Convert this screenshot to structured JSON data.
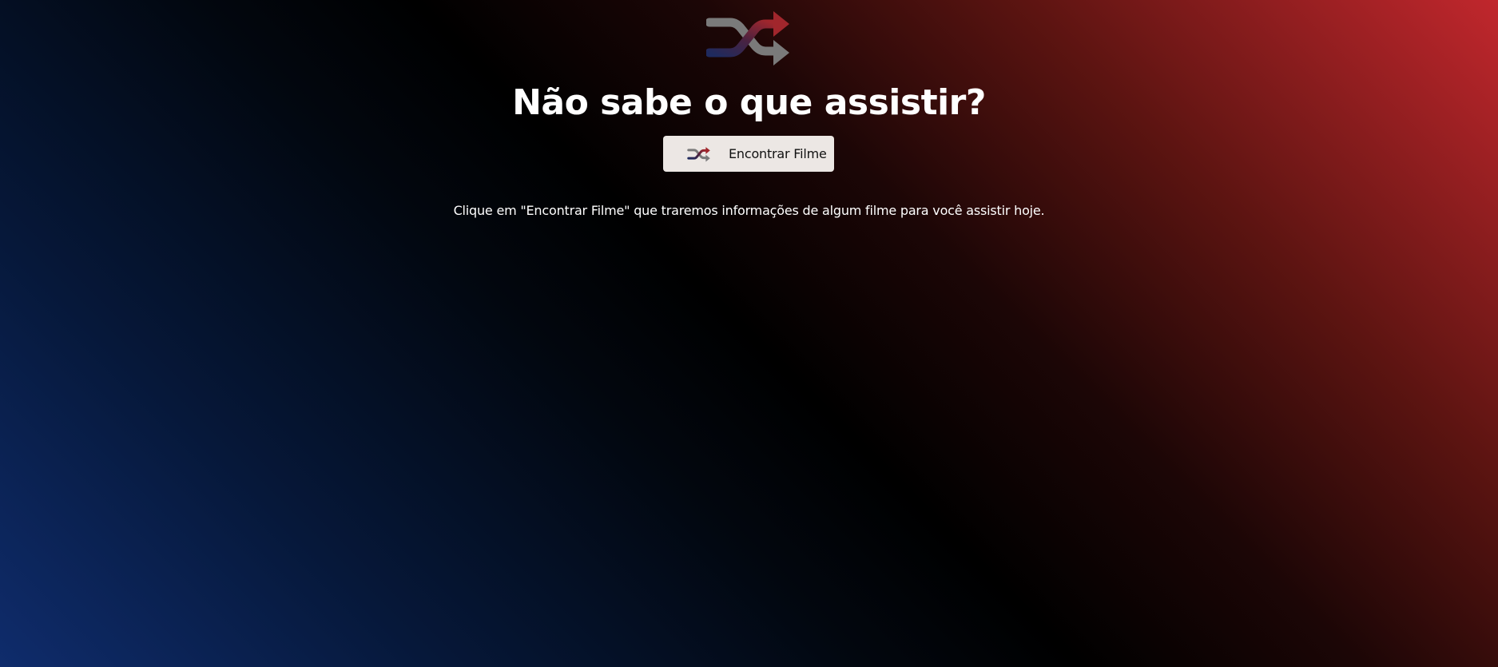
{
  "header": {
    "logo_icon": "shuffle-icon",
    "title": "Não sabe o que assistir?"
  },
  "actions": {
    "find_button_icon": "shuffle-icon",
    "find_button_label": "Encontrar Filme"
  },
  "hint_text": "Clique em \"Encontrar Filme\" que traremos informações de algum filme para você assistir hoje.",
  "colors": {
    "accent_red": "#c1272d",
    "accent_blue": "#0f2c6c",
    "icon_grey": "#7a7a7a",
    "button_bg": "#ece7e4"
  }
}
